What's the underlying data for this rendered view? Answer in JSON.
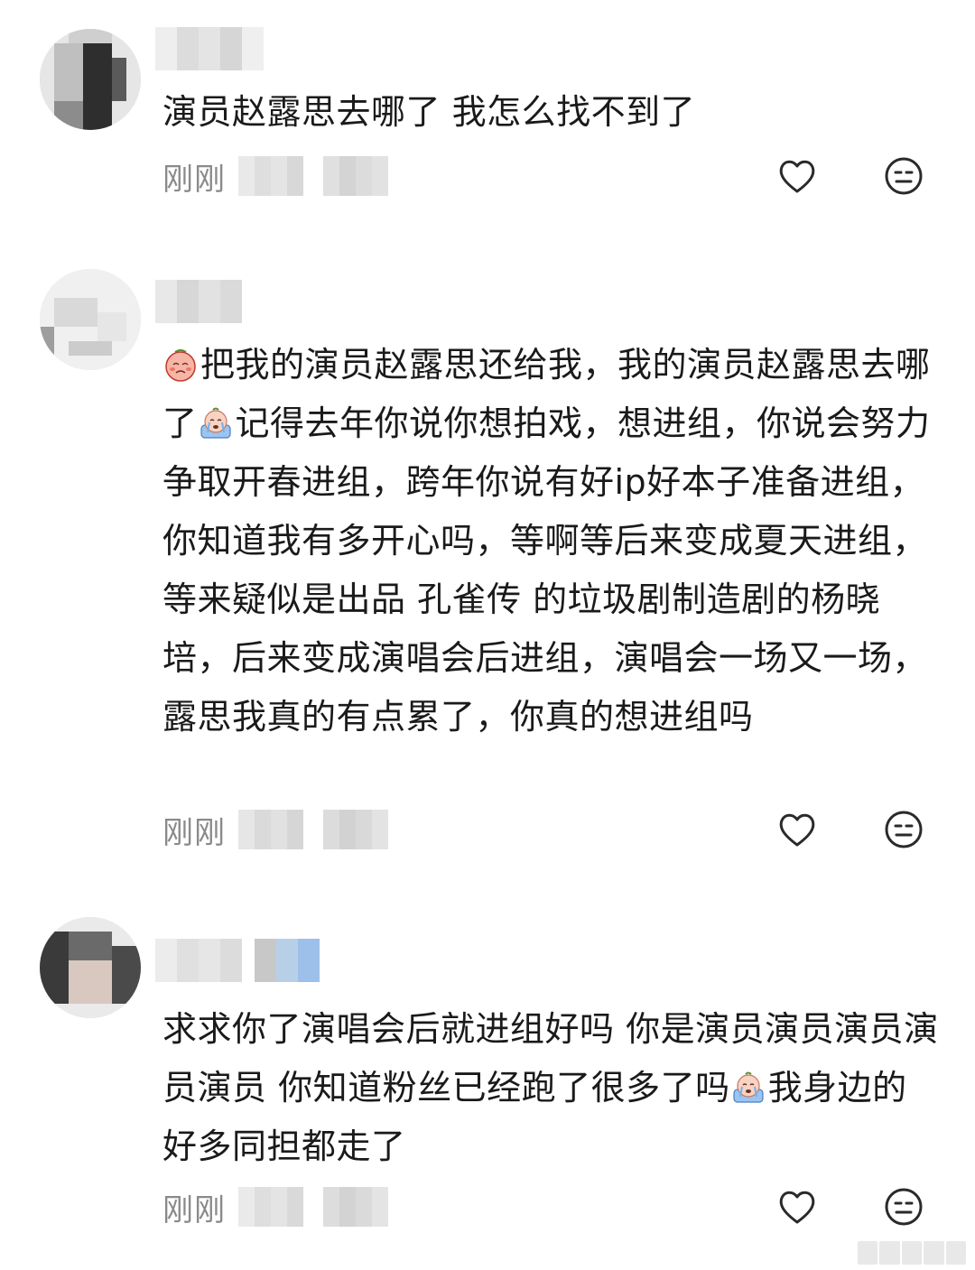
{
  "comments": [
    {
      "text": "演员赵露思去哪了 我怎么找不到了",
      "time": "刚刚"
    },
    {
      "emoji1": "sulking-face-emoji",
      "text_part1": "把我的演员赵露思还给我，我的演员赵露思去哪了",
      "emoji2": "crying-face-emoji",
      "text_part2": "记得去年你说你想拍戏，想进组，你说会努力争取开春进组，跨年你说有好ip好本子准备进组，你知道我有多开心吗，等啊等后来变成夏天进组，等来疑似是出品 孔雀传 的垃圾剧制造剧的杨晓培，后来变成演唱会后进组，演唱会一场又一场，露思我真的有点累了，你真的想进组吗",
      "time": "刚刚"
    },
    {
      "text_part1": "求求你了演唱会后就进组好吗 你是演员演员演员演员演员 你知道粉丝已经跑了很多了吗",
      "emoji": "crying-face-emoji",
      "text_part2": "我身边的好多同担都走了",
      "time": "刚刚"
    }
  ],
  "icons": {
    "like": "heart-outline-icon",
    "reaction": "neutral-face-icon"
  },
  "colors": {
    "text": "#1a1a1a",
    "meta": "#8a8a8a",
    "icon": "#2a2a2a",
    "background": "#ffffff"
  }
}
